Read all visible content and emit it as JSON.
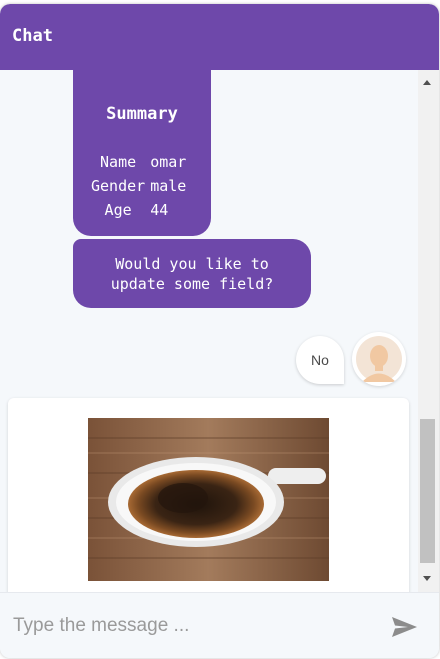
{
  "header": {
    "title": "Chat"
  },
  "messages": {
    "summary": {
      "title": "Summary",
      "rows": [
        {
          "key": "Name",
          "value": "omar"
        },
        {
          "key": "Gender",
          "value": "male"
        },
        {
          "key": "Age",
          "value": "44"
        }
      ]
    },
    "question": "Would you like to\nupdate some field?",
    "user_reply": "No",
    "image_card": {
      "image_icon": "coffee-cup-photo"
    }
  },
  "composer": {
    "placeholder": "Type the message ...",
    "value": "",
    "send_icon": "send-icon"
  },
  "colors": {
    "accent": "#6e48aa",
    "background": "#f5f8fb"
  }
}
